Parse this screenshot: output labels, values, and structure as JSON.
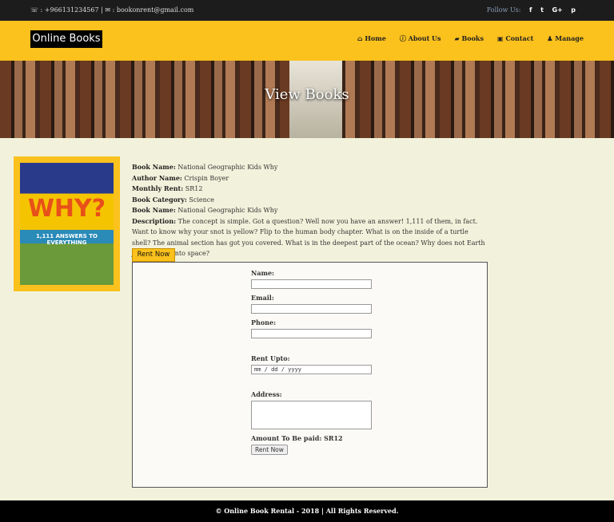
{
  "topbar": {
    "phone": "+966131234567",
    "email": "bookonrent@gmail.com",
    "follow_label": "Follow Us:",
    "social": [
      "f",
      "t",
      "G+",
      "p"
    ]
  },
  "header": {
    "logo": "Online Books",
    "nav": [
      {
        "icon": "home-icon",
        "label": "Home"
      },
      {
        "icon": "info-icon",
        "label": "About Us"
      },
      {
        "icon": "book-icon",
        "label": "Books"
      },
      {
        "icon": "contact-icon",
        "label": "Contact"
      },
      {
        "icon": "user-icon",
        "label": "Manage"
      }
    ]
  },
  "banner": {
    "title": "View Books"
  },
  "cover": {
    "title": "WHY?",
    "subtitle": "1,111 ANSWERS TO EVERYTHING"
  },
  "book": {
    "name_label": "Book Name:",
    "name": "National Geographic Kids Why",
    "author_label": "Author Name:",
    "author": "Crispin Boyer",
    "rent_label": "Monthly Rent:",
    "rent": "SR12",
    "category_label": "Book Category:",
    "category": "Science",
    "name2_label": "Book Name:",
    "name2": "National Geographic Kids Why",
    "desc_label": "Description:",
    "description": "The concept is simple. Got a question? Well now you have an answer! 1,111 of them, in fact. Want to know why your snot is yellow? Flip to the human body chapter. What is on the inside of a turtle shell? The animal section has got you covered. What is in the deepest part of the ocean? Why does not Earth just float off into space?",
    "rent_now": "Rent Now"
  },
  "form": {
    "name_label": "Name:",
    "email_label": "Email:",
    "phone_label": "Phone:",
    "rent_upto_label": "Rent Upto:",
    "date_placeholder": "mm / dd / yyyy",
    "address_label": "Address:",
    "amount_label": "Amount To Be paid: SR12",
    "submit": "Rent Now"
  },
  "footer": {
    "text": "© Online Book Rental - 2018 | All Rights Reserved."
  },
  "colors": {
    "accent": "#fbc11c",
    "topbar": "#1c1c1c",
    "background": "#f2f2dc"
  }
}
